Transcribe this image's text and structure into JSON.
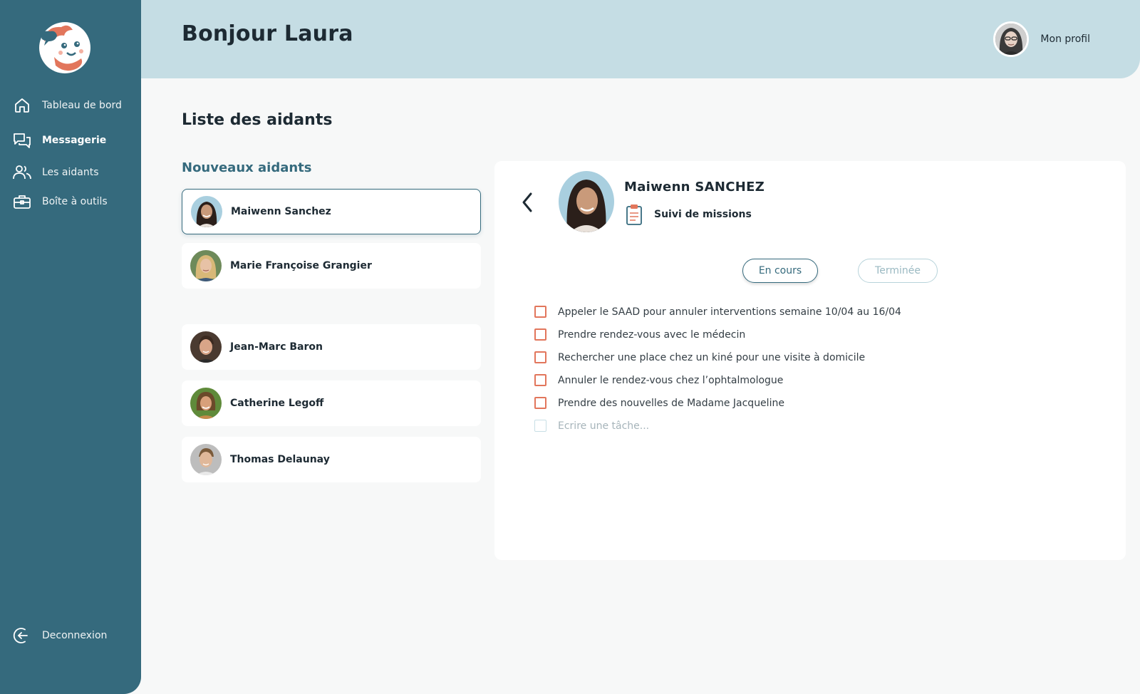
{
  "sidebar": {
    "items": [
      {
        "label": "Tableau de bord",
        "icon": "home-icon"
      },
      {
        "label": "Messagerie",
        "icon": "chat-icon"
      },
      {
        "label": "Les aidants",
        "icon": "users-icon"
      },
      {
        "label": "Boîte à outils",
        "icon": "toolbox-icon"
      }
    ],
    "logout": {
      "label": "Deconnexion",
      "icon": "logout-icon"
    }
  },
  "header": {
    "greeting": "Bonjour Laura",
    "profile_label": "Mon profil"
  },
  "main": {
    "title": "Liste des aidants",
    "section_title": "Nouveaux aidants",
    "carers": [
      {
        "name": "Maiwenn Sanchez",
        "selected": true
      },
      {
        "name": "Marie Françoise Grangier",
        "selected": false
      },
      {
        "name": "Jean-Marc Baron",
        "selected": false
      },
      {
        "name": "Catherine Legoff",
        "selected": false
      },
      {
        "name": "Thomas Delaunay",
        "selected": false
      }
    ]
  },
  "detail": {
    "name": "Maiwenn SANCHEZ",
    "mission_label": "Suivi de missions",
    "tabs": {
      "active": "En cours",
      "inactive": "Terminée"
    },
    "tasks": [
      "Appeler le SAAD pour annuler interventions semaine 10/04 au 16/04",
      "Prendre rendez-vous avec le médecin",
      "Rechercher une place chez un kiné pour une visite à domicile",
      "Annuler le rendez-vous chez l’ophtalmologue",
      "Prendre des nouvelles de Madame Jacqueline"
    ],
    "new_task_placeholder": "Ecrire une tâche..."
  },
  "colors": {
    "sidebar": "#356a7d",
    "header": "#c5dde4",
    "accent": "#e2765c",
    "background": "#f7f8f8"
  }
}
